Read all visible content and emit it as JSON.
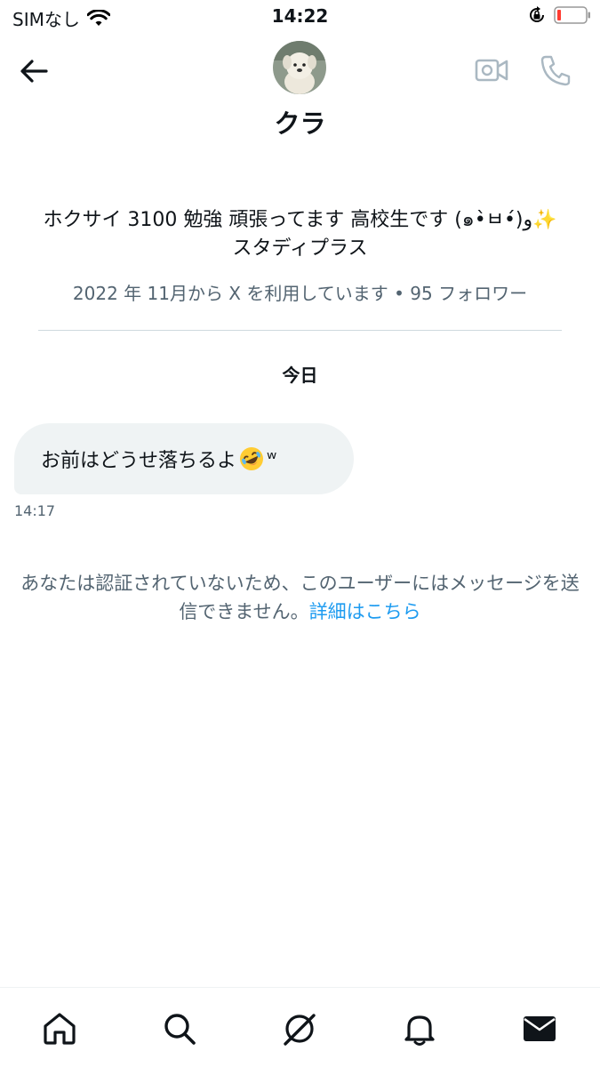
{
  "status_bar": {
    "carrier": "SIMなし",
    "time": "14:22"
  },
  "header": {
    "name": "クラ"
  },
  "profile": {
    "bio": "ホクサイ 3100 勉強 頑張ってます 高校生です (๑•̀ㅂ•́)و✨　スタディプラス",
    "meta": "2022 年 11月から X を利用しています • 95 フォロワー"
  },
  "conversation": {
    "date_label": "今日",
    "messages": [
      {
        "text_before": "お前はどうせ落ちるよ",
        "text_after": "ʷ",
        "time": "14:17"
      }
    ]
  },
  "notice": {
    "text": "あなたは認証されていないため、このユーザーにはメッセージを送信できません。",
    "link": "詳細はこちら"
  },
  "colors": {
    "text": "#0f1419",
    "secondary": "#536471",
    "link": "#1d9bf0",
    "bubble": "#eff3f4"
  },
  "icons": {
    "header": [
      "back-arrow-icon",
      "video-camera-icon",
      "phone-icon"
    ],
    "nav": [
      "home-icon",
      "search-icon",
      "grok-icon",
      "bell-icon",
      "mail-icon"
    ]
  }
}
